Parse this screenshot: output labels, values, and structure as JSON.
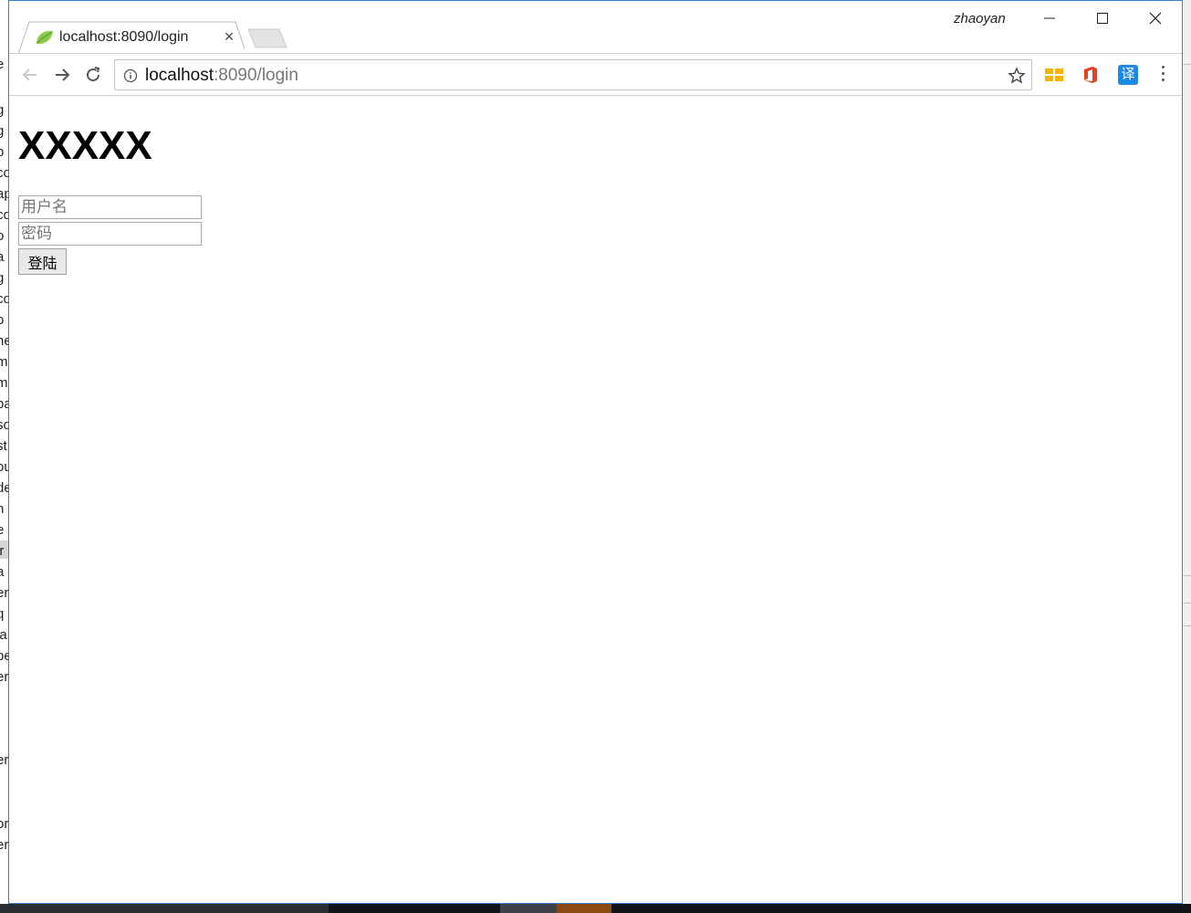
{
  "background_left_fragments": [
    "e",
    "g",
    "g",
    "p",
    "co",
    "ap",
    "co",
    "o",
    "a",
    "g",
    "co",
    "o",
    "ne",
    "m",
    "m",
    "pa",
    "so",
    "st",
    "ou",
    "de",
    "n",
    "e",
    "ir",
    "a",
    "er",
    "q",
    "ja",
    "pe",
    "er",
    "l",
    "er",
    "or",
    "er"
  ],
  "tab": {
    "title": "localhost:8090/login",
    "close_glyph": "×",
    "favicon": "spring-leaf-icon"
  },
  "titlebar": {
    "user": "zhaoyan"
  },
  "address_bar": {
    "host": "localhost",
    "rest": ":8090/login"
  },
  "extensions": {
    "translate_label": "译"
  },
  "page": {
    "heading": "XXXXX",
    "username_placeholder": "用户名",
    "password_placeholder": "密码",
    "submit_label": "登陆"
  },
  "colors": {
    "window_border": "#3a7bd5",
    "office_icon": "#e8401c",
    "grid_icon": "#f5b400",
    "translate_icon": "#1e88e5",
    "favicon": "#8cc84b"
  }
}
